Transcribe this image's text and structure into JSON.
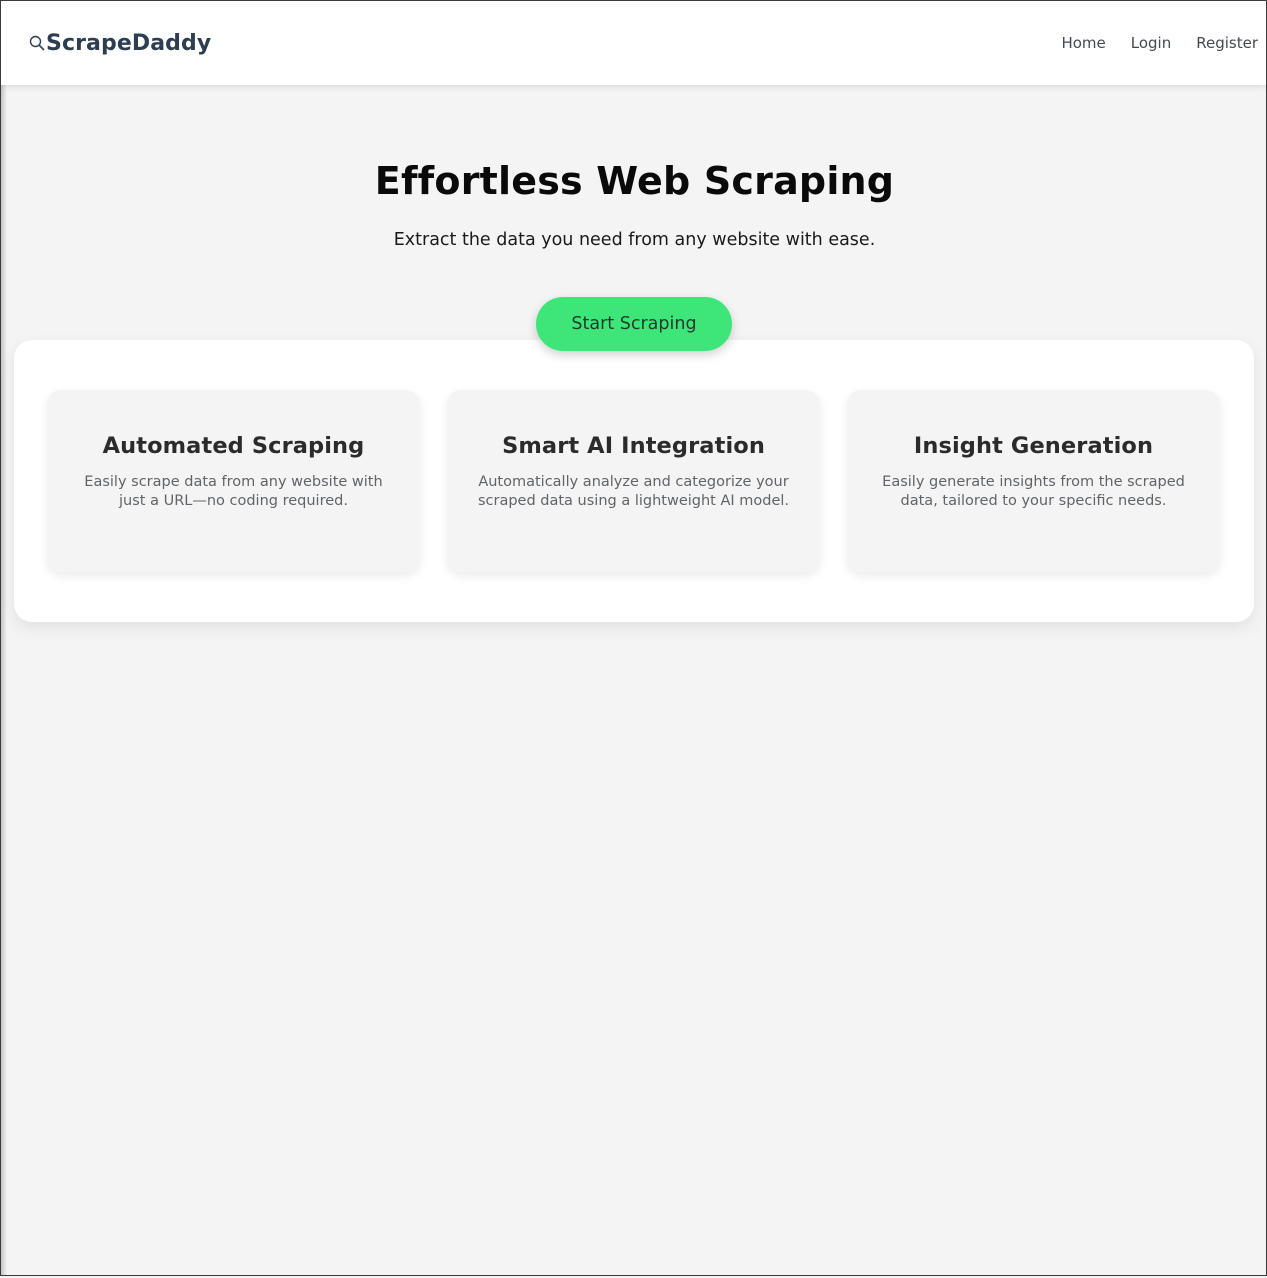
{
  "header": {
    "logo_icon": "search-icon",
    "logo_text": "ScrapeDaddy",
    "nav": [
      {
        "label": "Home"
      },
      {
        "label": "Login"
      },
      {
        "label": "Register"
      }
    ]
  },
  "hero": {
    "title": "Effortless Web Scraping",
    "subtitle": "Extract the data you need from any website with ease.",
    "cta_label": "Start Scraping"
  },
  "features": [
    {
      "title": "Automated Scraping",
      "description": "Easily scrape data from any website with just a URL—no coding required."
    },
    {
      "title": "Smart AI Integration",
      "description": "Automatically analyze and categorize your scraped data using a lightweight AI model."
    },
    {
      "title": "Insight Generation",
      "description": "Easily generate insights from the scraped data, tailored to your specific needs."
    }
  ],
  "colors": {
    "accent": "#3ee67a",
    "logo": "#2c3e50",
    "background": "#f4f4f4"
  }
}
